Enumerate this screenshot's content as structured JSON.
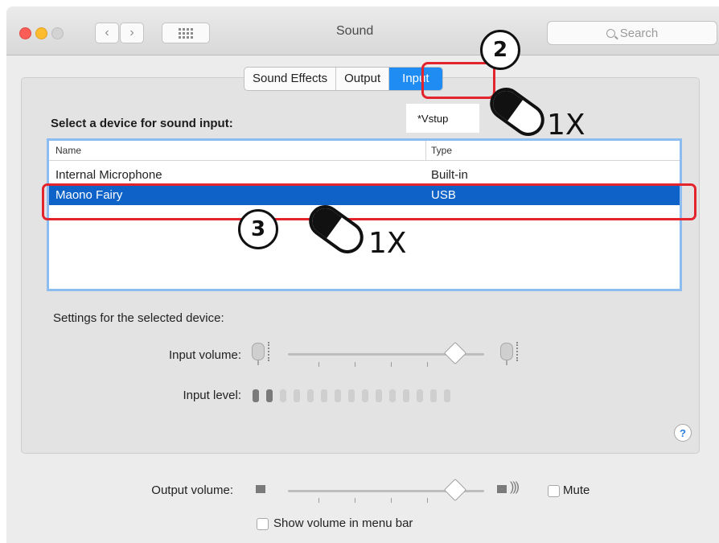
{
  "window": {
    "title": "Sound",
    "search_placeholder": "Search"
  },
  "tabs": [
    {
      "label": "Sound Effects",
      "active": false
    },
    {
      "label": "Output",
      "active": false
    },
    {
      "label": "Input",
      "active": true
    }
  ],
  "tooltip": "*Vstup",
  "input": {
    "select_label": "Select a device for sound input:",
    "columns": {
      "name": "Name",
      "type": "Type"
    },
    "devices": [
      {
        "name": "Internal Microphone",
        "type": "Built-in",
        "selected": false
      },
      {
        "name": "Maono Fairy",
        "type": "USB",
        "selected": true
      }
    ],
    "settings_label": "Settings for the selected device:",
    "input_volume_label": "Input volume:",
    "input_volume_level": 0.85,
    "input_level_label": "Input level:",
    "input_level_bars_total": 15,
    "input_level_bars_on": 2
  },
  "output": {
    "volume_label": "Output volume:",
    "volume_level": 0.85,
    "mute_label": "Mute",
    "mute_checked": false,
    "show_volume_label": "Show volume in menu bar",
    "show_volume_checked": false
  },
  "annotations": [
    {
      "step": "2",
      "clicks": "1X"
    },
    {
      "step": "3",
      "clicks": "1X"
    }
  ],
  "colors": {
    "accent": "#1f8cf4",
    "selection": "#0f63c8",
    "annotation_red": "#e4242d"
  }
}
